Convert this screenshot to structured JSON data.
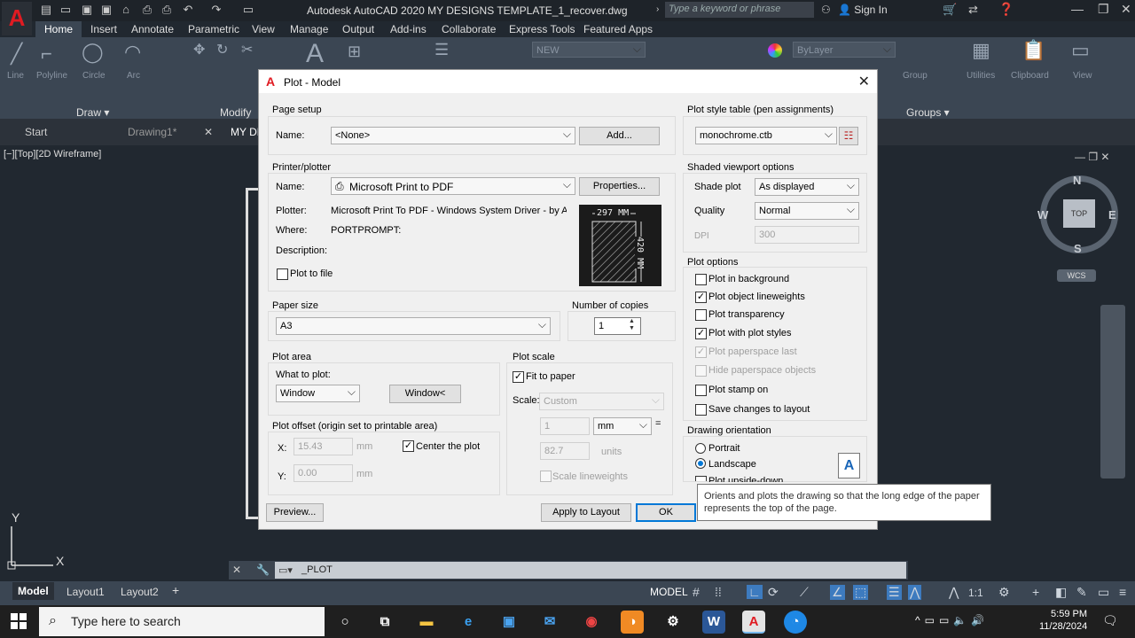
{
  "app": {
    "logo_letter": "A",
    "title": "Autodesk AutoCAD 2020    MY DESIGNS TEMPLATE_1_recover.dwg",
    "search_placeholder": "Type a keyword or phrase",
    "sign_in": "Sign In"
  },
  "ribbon": {
    "tabs": [
      "Home",
      "Insert",
      "Annotate",
      "Parametric",
      "View",
      "Manage",
      "Output",
      "Add-ins",
      "Collaborate",
      "Express Tools",
      "Featured Apps"
    ],
    "active_tab": "Home",
    "tools": [
      "Line",
      "Polyline",
      "Circle",
      "Arc"
    ],
    "panels": [
      "Draw ▾",
      "Modify",
      "Groups ▾"
    ],
    "layer_value": "NEW",
    "bylayer": "ByLayer",
    "right_tools": [
      "Group",
      "Utilities",
      "Clipboard",
      "View"
    ]
  },
  "doc_tabs": [
    "Start",
    "Drawing1*",
    "MY DE"
  ],
  "viewport_label": "[−][Top][2D Wireframe]",
  "navcube": {
    "top": "TOP",
    "n": "N",
    "s": "S",
    "e": "E",
    "w": "W",
    "wcs": "WCS"
  },
  "ucs": {
    "x": "X",
    "y": "Y"
  },
  "dialog": {
    "title": "Plot - Model",
    "page_setup": {
      "heading": "Page setup",
      "name_label": "Name:",
      "name_value": "<None>",
      "add_button": "Add..."
    },
    "printer": {
      "heading": "Printer/plotter",
      "name_label": "Name:",
      "name_value": "Microsoft Print to PDF",
      "properties_button": "Properties...",
      "plotter_label": "Plotter:",
      "plotter_value": "Microsoft Print To PDF - Windows System Driver - by Au...",
      "where_label": "Where:",
      "where_value": "PORTPROMPT:",
      "description_label": "Description:",
      "plot_to_file": "Plot to file",
      "preview_width": "297 MM",
      "preview_height": "420 MM"
    },
    "paper_size": {
      "heading": "Paper size",
      "value": "A3"
    },
    "copies": {
      "heading": "Number of copies",
      "value": "1"
    },
    "plot_area": {
      "heading": "Plot area",
      "what_label": "What to plot:",
      "value": "Window",
      "window_button": "Window<"
    },
    "plot_offset": {
      "heading": "Plot offset (origin set to printable area)",
      "x_label": "X:",
      "x_value": "15.43",
      "y_label": "Y:",
      "y_value": "0.00",
      "unit": "mm",
      "center_label": "Center the plot",
      "center_checked": true
    },
    "plot_scale": {
      "heading": "Plot scale",
      "fit_label": "Fit to paper",
      "fit_checked": true,
      "scale_label": "Scale:",
      "scale_value": "Custom",
      "val1": "1",
      "unit1": "mm",
      "equals": "=",
      "val2": "82.7",
      "unit2": "units",
      "lineweights": "Scale lineweights"
    },
    "plot_style": {
      "heading": "Plot style table (pen assignments)",
      "value": "monochrome.ctb"
    },
    "shaded": {
      "heading": "Shaded viewport options",
      "shade_label": "Shade plot",
      "shade_value": "As displayed",
      "quality_label": "Quality",
      "quality_value": "Normal",
      "dpi_label": "DPI",
      "dpi_value": "300"
    },
    "plot_options": {
      "heading": "Plot options",
      "items": [
        {
          "label": "Plot in background",
          "checked": false,
          "disabled": false
        },
        {
          "label": "Plot object lineweights",
          "checked": true,
          "disabled": false
        },
        {
          "label": "Plot transparency",
          "checked": false,
          "disabled": false
        },
        {
          "label": "Plot with plot styles",
          "checked": true,
          "disabled": false
        },
        {
          "label": "Plot paperspace last",
          "checked": true,
          "disabled": true
        },
        {
          "label": "Hide paperspace objects",
          "checked": false,
          "disabled": true
        },
        {
          "label": "Plot stamp on",
          "checked": false,
          "disabled": false
        },
        {
          "label": "Save changes to layout",
          "checked": false,
          "disabled": false
        }
      ]
    },
    "orientation": {
      "heading": "Drawing orientation",
      "portrait": "Portrait",
      "landscape": "Landscape",
      "upside": "Plot upside-down",
      "selected": "Landscape"
    },
    "buttons": {
      "preview": "Preview...",
      "apply": "Apply to Layout",
      "ok": "OK"
    },
    "tooltip": "Orients and plots the drawing so that the long edge of the paper represents the top of the page."
  },
  "command": {
    "text": "_PLOT"
  },
  "layout_tabs": [
    "Model",
    "Layout1",
    "Layout2"
  ],
  "status": {
    "model": "MODEL",
    "scale": "1:1"
  },
  "taskbar": {
    "search_placeholder": "Type here to search",
    "time": "5:59 PM",
    "date": "11/28/2024"
  }
}
